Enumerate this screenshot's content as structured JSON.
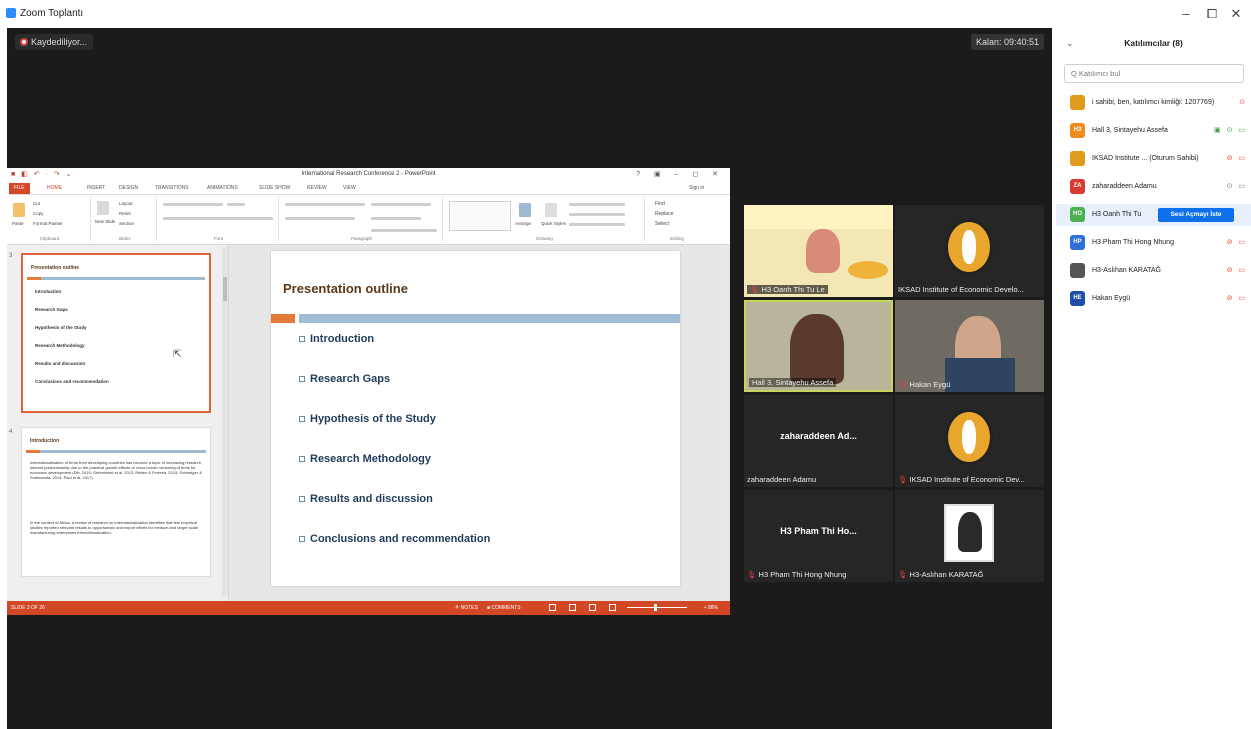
{
  "window": {
    "title": "Zoom Toplantı",
    "minimize": "–",
    "maximize": "⧠",
    "close": "✕"
  },
  "meeting": {
    "recording": "Kaydediliyor...",
    "timer": "Kalan: 09:40:51"
  },
  "ppt": {
    "title": "International Research Conference 2 - PowerPoint",
    "qat": "■ ◧ ↶ · ↷ ⌄",
    "winctl": "? ▣ – ◻ ✕",
    "tabs": [
      "FILE",
      "HOME",
      "INSERT",
      "DESIGN",
      "TRANSITIONS",
      "ANIMATIONS",
      "SLIDE SHOW",
      "REVIEW",
      "VIEW"
    ],
    "signin": "Sign in",
    "ribbon": [
      "Clipboard",
      "Slides",
      "Font",
      "Paragraph",
      "Drawing",
      "Editing"
    ],
    "ribbon_cmds": {
      "cut": "Cut",
      "copy": "Copy",
      "format_painter": "Format Painter",
      "paste": "Paste",
      "layout": "Layout",
      "reset": "Reset",
      "section": "Section",
      "new_slide": "New Slide",
      "find": "Find",
      "replace": "Replace",
      "select": "Select",
      "arrange": "Arrange",
      "quick_styles": "Quick Styles"
    },
    "slide": {
      "title": "Presentation outline",
      "items": [
        "Introduction",
        "Research Gaps",
        "Hypothesis of the Study",
        "Research Methodology",
        "Results and discussion",
        "Conclusions and recommendation"
      ]
    },
    "thumb2": {
      "num": "4",
      "title": "Introduction",
      "para1": "Internationalisation of firms from developing countries has become a topic of increasing research interest predominantly due to the practical growth effects of cross border venturing of firms for economic development (Dib, 2015; Gebrehiwet et al. 2012; Ratten & Ferreira, 2015; Schweiger & Sudimanda, 2014; Paul et al, 2017).",
      "para2": "In the context of Africa, a review of research on internationalization identifies that few empirical studies reported relevant results to opportunistic and export efforts for medium and larger scale manufacturing enterprises internationalization."
    },
    "thumb1_num": "3",
    "status": {
      "slide": "SLIDE 3 OF 26",
      "notes": "≜ NOTES",
      "comments": "■ COMMENTS",
      "zoom": "+ 88%"
    }
  },
  "tiles": [
    {
      "name": "H3 Oanh Thi Tu Le",
      "muted": true
    },
    {
      "name": "IKSAD Institute of Economic Develo...",
      "muted": false
    },
    {
      "name": "Hall 3, Sintayehu Assefa",
      "muted": false
    },
    {
      "name": "Hakan Eygü",
      "muted": true
    },
    {
      "name": "zaharaddeen Adamu",
      "center": "zaharaddeen  Ad...",
      "muted": false
    },
    {
      "name": "IKSAD Institute of Economic Dev...",
      "muted": true
    },
    {
      "name": "H3 Pham Thi Hong Nhung",
      "center": "H3  Pham  Thi  Ho...",
      "muted": true
    },
    {
      "name": "H3-Aslıhan KARATAĞ",
      "muted": true
    }
  ],
  "panel": {
    "title": "Katılımcılar (8)",
    "search_placeholder": "Katılımcı bul",
    "chevron": "⌄",
    "participants": [
      {
        "initials": "",
        "color": "#e09a1e",
        "name": "i sahibi, ben, katılımcı kimliği: 1207769)",
        "icons": "⊙"
      },
      {
        "initials": "H3",
        "color": "#f08c1e",
        "name": "Hall 3, Sintayehu Assefa",
        "icons": "▣ ⊙ ▭"
      },
      {
        "initials": "",
        "color": "#e09a1e",
        "name": "IKSAD Institute ...  (Oturum Sahibi)",
        "icons": "⊘ ▭"
      },
      {
        "initials": "ZA",
        "color": "#d73a30",
        "name": "zaharaddeen Adamu",
        "icons": "⊙ ▭"
      },
      {
        "initials": "HO",
        "color": "#4caf50",
        "name": "H3 Oanh Thi Tu",
        "button": "Sesi Açmayı İste"
      },
      {
        "initials": "HP",
        "color": "#2d6fd8",
        "name": "H3 Pham Thi Hong Nhung",
        "icons": "⊘ ▭"
      },
      {
        "initials": "",
        "color": "#555555",
        "name": "H3-Aslıhan KARATAĞ",
        "icons": "⊘ ▭"
      },
      {
        "initials": "HE",
        "color": "#1f4ea8",
        "name": "Hakan Eygü",
        "icons": "⊘ ▭"
      }
    ]
  }
}
